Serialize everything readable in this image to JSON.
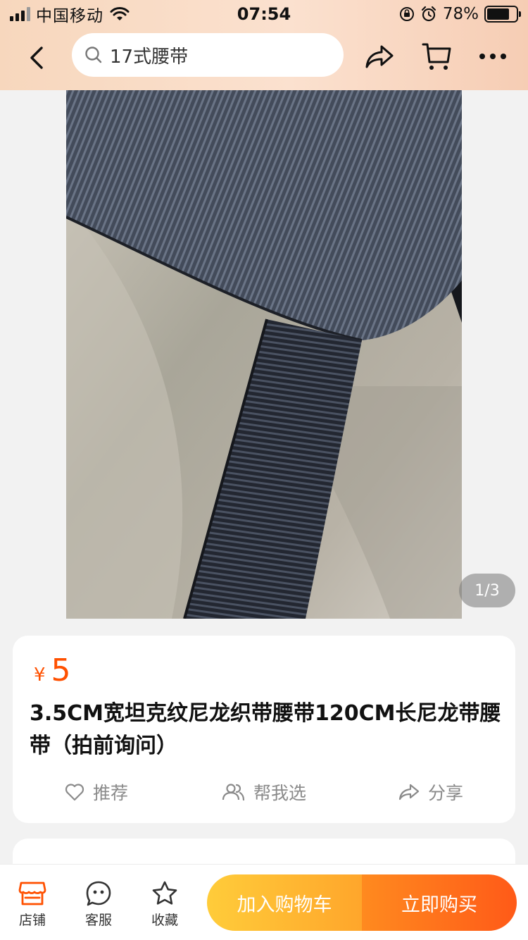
{
  "status_bar": {
    "carrier": "中国移动",
    "time": "07:54",
    "battery": "78%",
    "battery_level": 0.78
  },
  "nav": {
    "search_value": "17式腰带",
    "icons": [
      "back-icon",
      "search-icon",
      "share-icon",
      "cart-icon",
      "more-icon"
    ]
  },
  "gallery": {
    "indicator": "1/3",
    "image_description_icon": "product-photo"
  },
  "product": {
    "currency": "¥",
    "price": "5",
    "title": "3.5CM宽坦克纹尼龙织带腰带120CM长尼龙带腰带（拍前询问）",
    "actions": [
      {
        "label": "推荐",
        "icon": "heart-icon"
      },
      {
        "label": "帮我选",
        "icon": "people-icon"
      },
      {
        "label": "分享",
        "icon": "share-icon"
      }
    ]
  },
  "bottom_bar": {
    "tabs": [
      {
        "label": "店铺",
        "icon": "store-icon"
      },
      {
        "label": "客服",
        "icon": "service-icon"
      },
      {
        "label": "收藏",
        "icon": "star-icon"
      }
    ],
    "add_to_cart": "加入购物车",
    "buy_now": "立即购买"
  },
  "colors": {
    "accent": "#ff5000",
    "cart_button": "#ffb42e",
    "buy_button": "#ff6a1a",
    "header_bg": "#f9dcc6"
  }
}
